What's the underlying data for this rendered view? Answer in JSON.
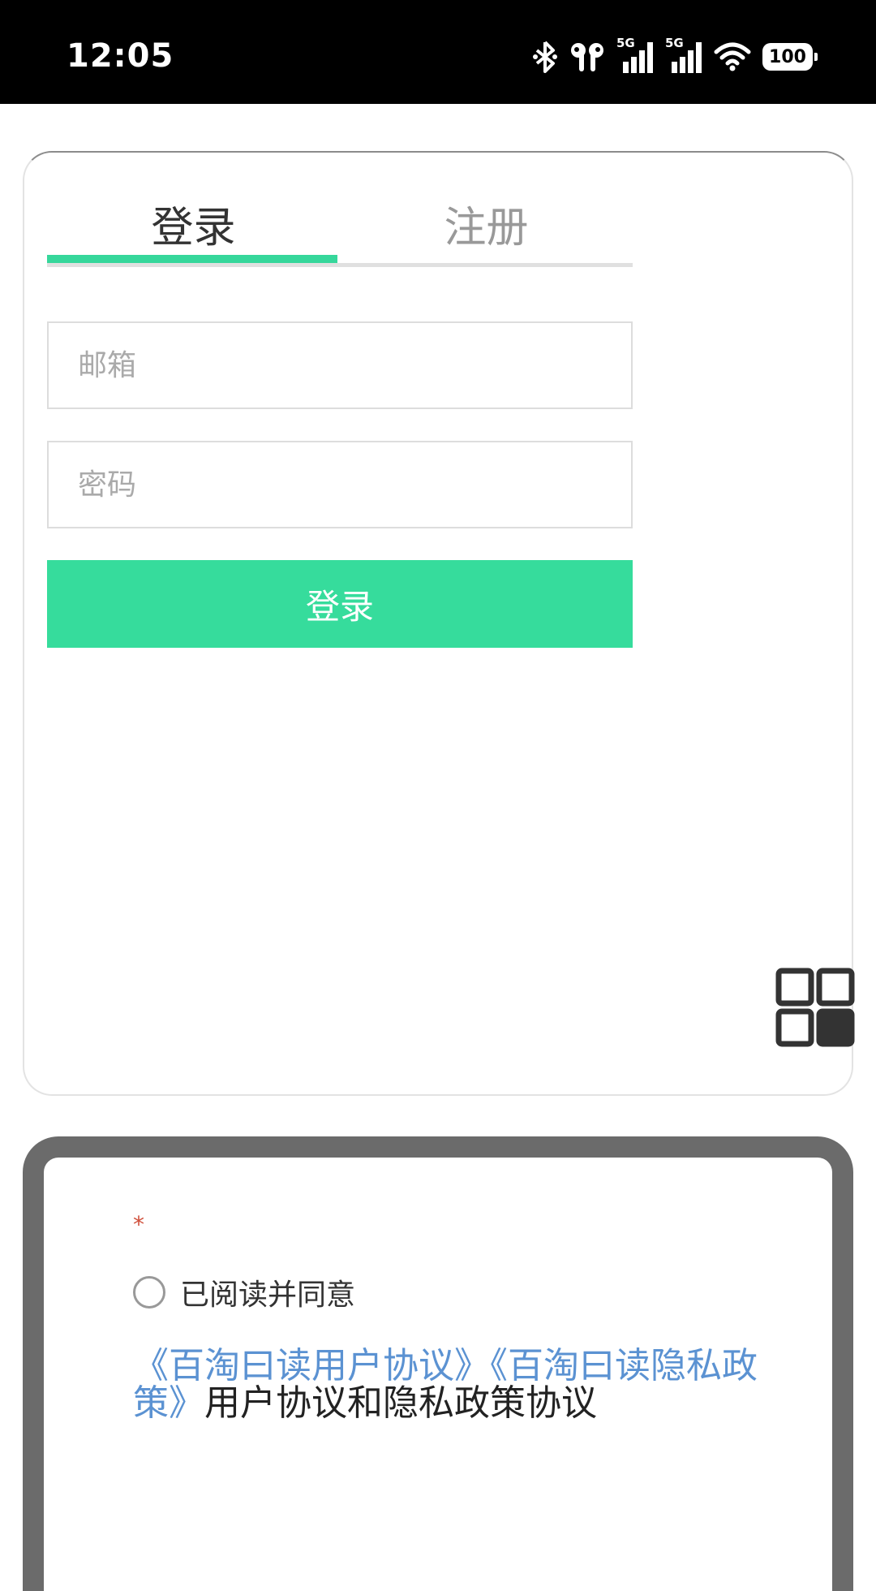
{
  "status_bar": {
    "time": "12:05",
    "network_1": "5G",
    "network_2": "5G",
    "battery": "100",
    "icons": [
      "bluetooth-icon",
      "earbuds-icon",
      "signal-5g-icon",
      "signal-5g-icon",
      "wifi-icon",
      "battery-icon"
    ]
  },
  "login": {
    "tabs": [
      {
        "label": "登录",
        "active": true
      },
      {
        "label": "注册",
        "active": false
      }
    ],
    "email_placeholder": "邮箱",
    "email_value": "",
    "password_placeholder": "密码",
    "password_value": "",
    "submit_label": "登录",
    "accent_color": "#36d79b"
  },
  "agreement": {
    "required_mark": "*",
    "checkbox_label": "已阅读并同意",
    "link_user": "《百淘曰读用户协议》",
    "link_privacy": "《百淘曰读隐私政策》",
    "tail_text": "用户协议和隐私政策协议",
    "link_color": "#5b92d2"
  },
  "floating": {
    "icon": "grid-icon"
  }
}
